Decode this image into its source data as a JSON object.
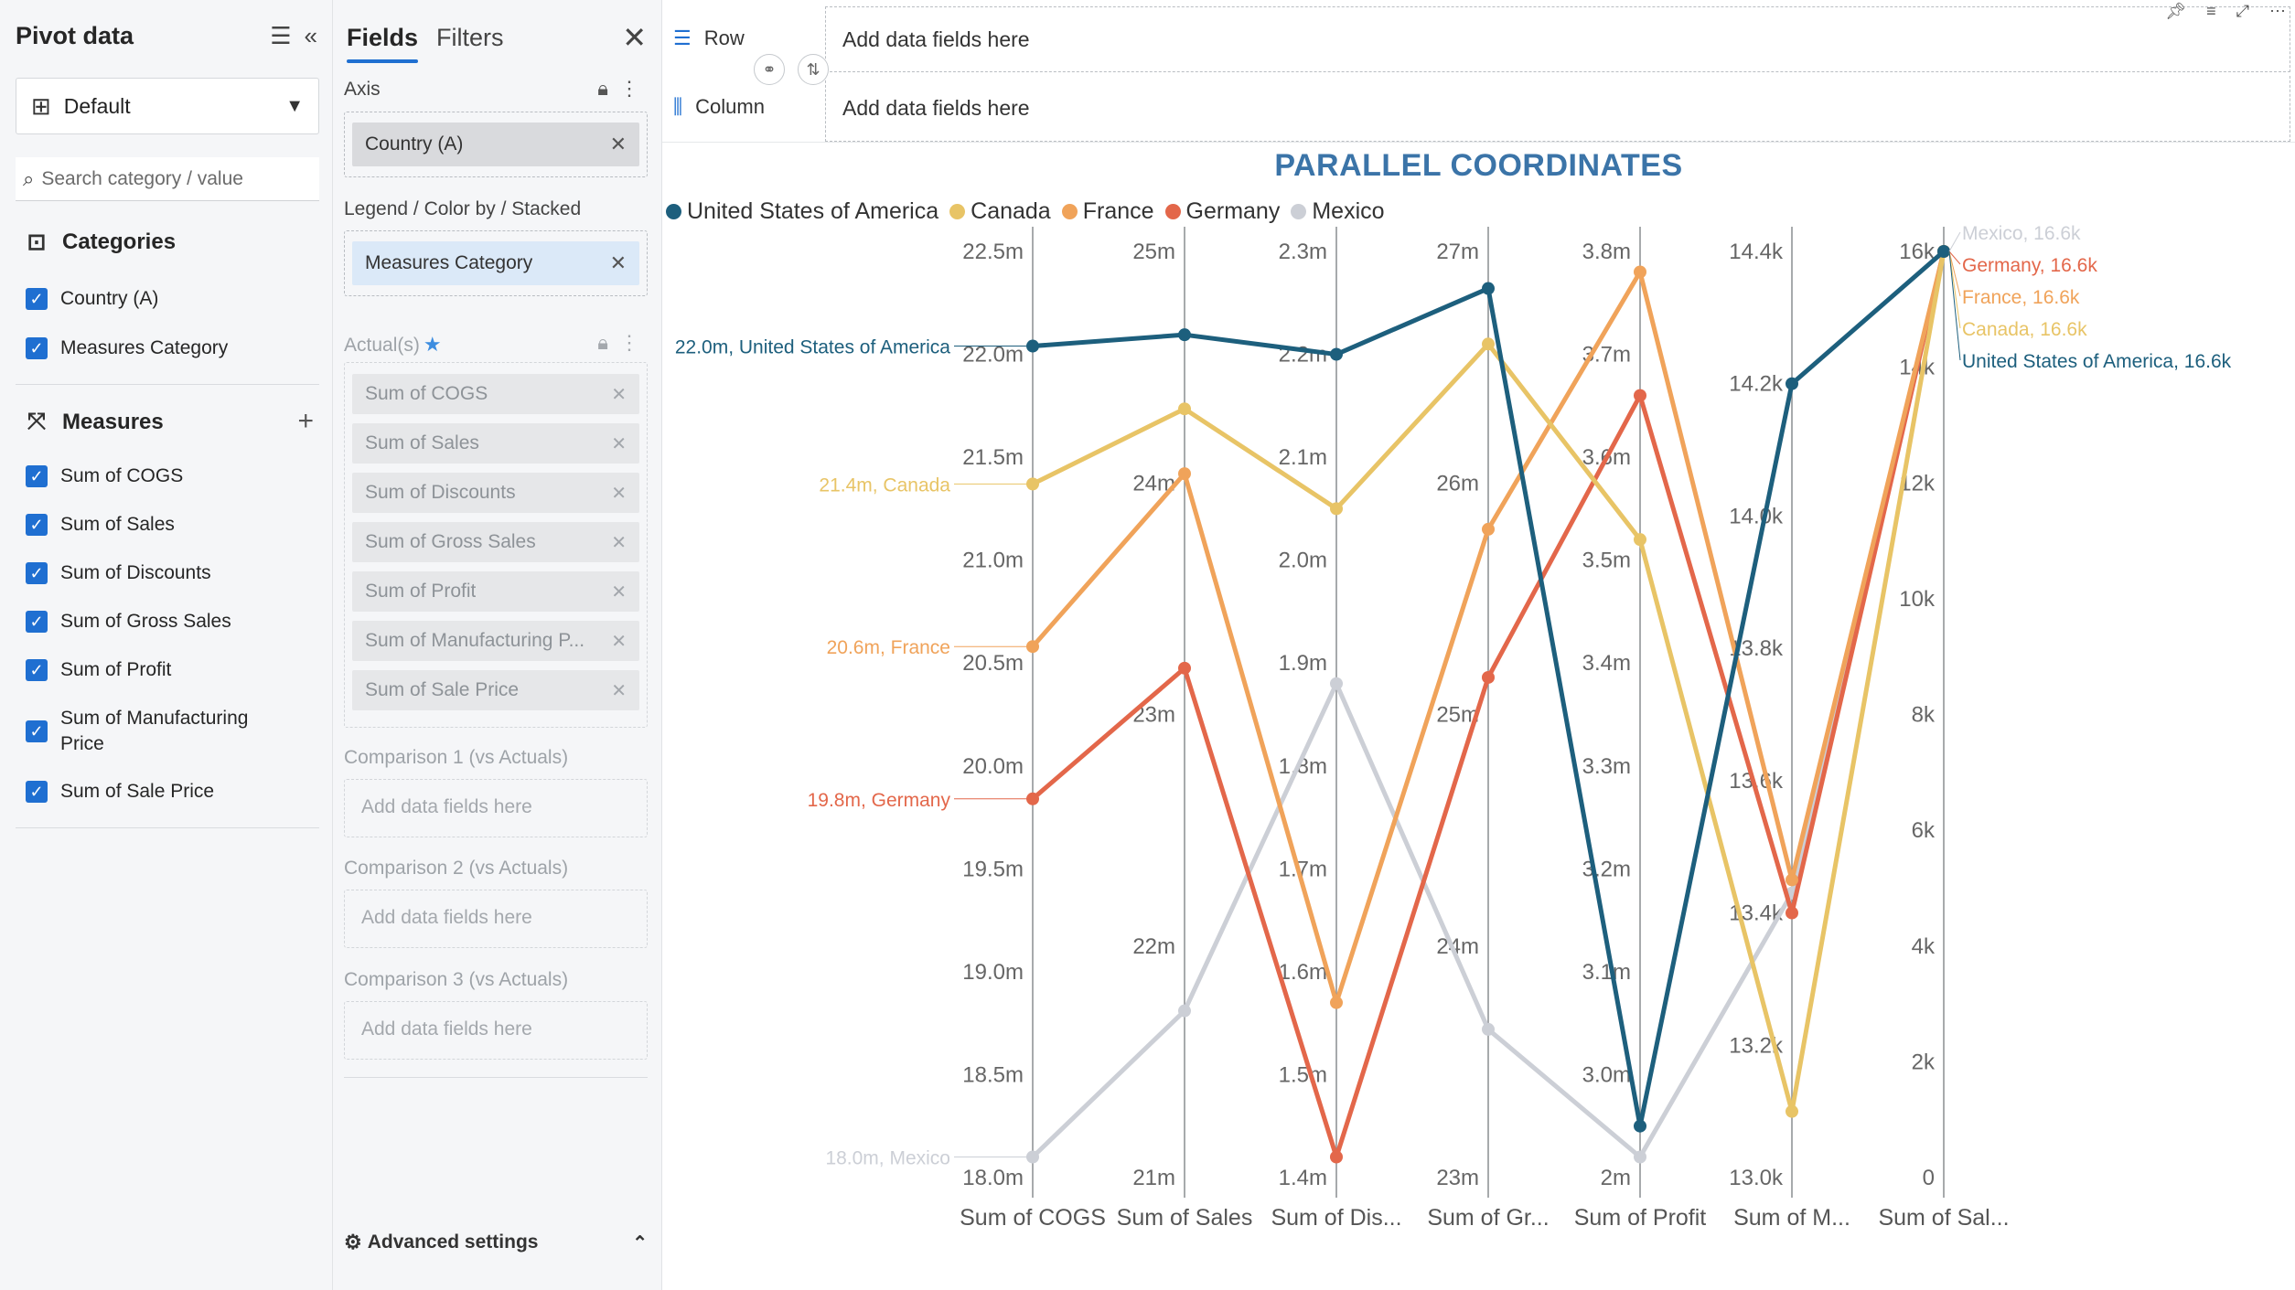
{
  "pivot": {
    "title": "Pivot data",
    "view_select": "Default",
    "search_placeholder": "Search category / value",
    "categories_heading": "Categories",
    "categories": [
      "Country (A)",
      "Measures Category"
    ],
    "measures_heading": "Measures",
    "measures": [
      "Sum of COGS",
      "Sum of Sales",
      "Sum of Discounts",
      "Sum of Gross Sales",
      "Sum of Profit",
      "Sum of Manufacturing Price",
      "Sum of Sale Price"
    ]
  },
  "fields": {
    "tab_fields": "Fields",
    "tab_filters": "Filters",
    "axis_label": "Axis",
    "axis_chip": "Country (A)",
    "legend_label": "Legend / Color by / Stacked",
    "legend_chip": "Measures Category",
    "actuals_label": "Actual(s)",
    "actual_chips": [
      "Sum of COGS",
      "Sum of Sales",
      "Sum of Discounts",
      "Sum of Gross Sales",
      "Sum of Profit",
      "Sum of Manufacturing P...",
      "Sum of Sale Price"
    ],
    "comparison1_label": "Comparison 1 (vs Actuals)",
    "comparison2_label": "Comparison 2 (vs Actuals)",
    "comparison3_label": "Comparison 3 (vs Actuals)",
    "add_placeholder": "Add data fields here",
    "advanced_settings": "Advanced settings"
  },
  "toolbar": {
    "row_label": "Row",
    "column_label": "Column",
    "row_placeholder": "Add data fields here",
    "column_placeholder": "Add data fields here"
  },
  "colors": {
    "usa": "#1d5f7d",
    "canada": "#e8c466",
    "france": "#f0a35a",
    "germany": "#e3674a",
    "mexico": "#cccfd6",
    "title": "#3b74a8",
    "accent": "#1f6fd1"
  },
  "chart_data": {
    "type": "parallel-coordinates",
    "title": "PARALLEL COORDINATES",
    "axes": [
      {
        "label": "Sum of COGS",
        "ticks": [
          "18.0m",
          "18.5m",
          "19.0m",
          "19.5m",
          "20.0m",
          "20.5m",
          "21.0m",
          "21.5m",
          "22.0m",
          "22.5m"
        ],
        "range": [
          18.0,
          22.5
        ]
      },
      {
        "label": "Sum of Sales",
        "ticks": [
          "21m",
          "22m",
          "23m",
          "24m",
          "25m"
        ],
        "range": [
          20.5,
          25.5
        ]
      },
      {
        "label": "Sum of Dis...",
        "ticks": [
          "1.4m",
          "1.5m",
          "1.6m",
          "1.7m",
          "1.8m",
          "1.9m",
          "2.0m",
          "2.1m",
          "2.2m",
          "2.3m"
        ],
        "range": [
          1.4,
          2.3
        ]
      },
      {
        "label": "Sum of Gr...",
        "ticks": [
          "23m",
          "24m",
          "25m",
          "26m",
          "27m"
        ],
        "range": [
          22.5,
          27.5
        ]
      },
      {
        "label": "Sum of Profit",
        "ticks": [
          "2m",
          "3.0m",
          "3.1m",
          "3.2m",
          "3.3m",
          "3.4m",
          "3.5m",
          "3.6m",
          "3.7m",
          "3.8m"
        ],
        "range": [
          2.94,
          3.84
        ]
      },
      {
        "label": "Sum of M...",
        "ticks": [
          "13.0k",
          "13.2k",
          "13.4k",
          "13.6k",
          "13.8k",
          "14.0k",
          "14.2k",
          "14.4k"
        ],
        "range": [
          13.0,
          14.4
        ]
      },
      {
        "label": "Sum of Sal...",
        "ticks": [
          "0",
          "2k",
          "4k",
          "6k",
          "8k",
          "10k",
          "12k",
          "14k",
          "16k"
        ],
        "range": [
          0,
          16.6
        ]
      }
    ],
    "series": [
      {
        "name": "United States of America",
        "values": [
          22.04,
          25.05,
          2.2,
          27.3,
          2.99,
          14.2,
          16.6
        ],
        "start_label": "22.0m, United States of America",
        "end_label": "United States of America, 16.6k"
      },
      {
        "name": "Canada",
        "values": [
          21.37,
          24.65,
          2.05,
          27.0,
          3.56,
          13.1,
          16.6
        ],
        "start_label": "21.4m, Canada",
        "end_label": "Canada, 16.6k"
      },
      {
        "name": "France",
        "values": [
          20.58,
          24.3,
          1.57,
          26.0,
          3.82,
          13.45,
          16.6
        ],
        "start_label": "20.6m, France",
        "end_label": "France, 16.6k"
      },
      {
        "name": "Germany",
        "values": [
          19.84,
          23.25,
          1.42,
          25.2,
          3.7,
          13.4,
          16.6
        ],
        "start_label": "19.8m, Germany",
        "end_label": "Germany, 16.6k"
      },
      {
        "name": "Mexico",
        "values": [
          18.1,
          21.4,
          1.88,
          23.3,
          2.96,
          13.43,
          16.6
        ],
        "start_label": "18.0m, Mexico",
        "end_label": "Mexico, 16.6k"
      }
    ]
  }
}
